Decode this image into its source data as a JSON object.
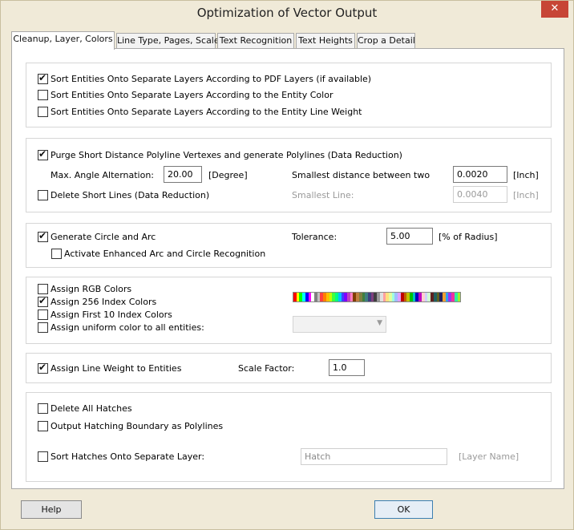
{
  "window": {
    "title": "Optimization of Vector Output",
    "close_glyph": "✕"
  },
  "tabs": [
    {
      "label": "Cleanup, Layer, Colors",
      "active": true
    },
    {
      "label": "Line Type, Pages, Scale",
      "active": false
    },
    {
      "label": "Text Recognition",
      "active": false
    },
    {
      "label": "Text Heights",
      "active": false
    },
    {
      "label": "Crop a Detail",
      "active": false
    }
  ],
  "layers": {
    "pdf_layers": {
      "label": "Sort Entities Onto Separate Layers According to PDF Layers (if available)",
      "checked": true
    },
    "entity_color": {
      "label": "Sort Entities Onto Separate Layers According to the Entity Color",
      "checked": false
    },
    "line_weight": {
      "label": "Sort Entities Onto Separate Layers According to the Entity Line Weight",
      "checked": false
    }
  },
  "reduction": {
    "purge": {
      "label": "Purge Short Distance Polyline Vertexes and generate Polylines (Data Reduction)",
      "checked": true
    },
    "max_angle_label": "Max. Angle Alternation:",
    "max_angle_value": "20.00",
    "max_angle_unit": "[Degree]",
    "smallest_distance_label": "Smallest distance between two",
    "smallest_distance_value": "0.0020",
    "smallest_distance_unit": "[Inch]",
    "delete_short": {
      "label": "Delete Short Lines (Data Reduction)",
      "checked": false
    },
    "smallest_line_label": "Smallest Line:",
    "smallest_line_value": "0.0040",
    "smallest_line_unit": "[Inch]"
  },
  "arcs": {
    "generate": {
      "label": "Generate Circle and Arc",
      "checked": true
    },
    "enhanced": {
      "label": "Activate Enhanced Arc and Circle Recognition",
      "checked": false
    },
    "tolerance_label": "Tolerance:",
    "tolerance_value": "5.00",
    "tolerance_unit": "[% of Radius]"
  },
  "colors": {
    "rgb": {
      "label": "Assign RGB Colors",
      "checked": false
    },
    "index256": {
      "label": "Assign 256 Index Colors",
      "checked": true
    },
    "first10": {
      "label": "Assign First 10 Index Colors",
      "checked": false
    },
    "uniform": {
      "label": "Assign uniform color to all entities:",
      "checked": false
    },
    "palette": [
      "#ff0000",
      "#ffff00",
      "#00ff00",
      "#00ffff",
      "#0000ff",
      "#ff00ff",
      "#ffffff",
      "#808080",
      "#c0c0c0",
      "#ff3f3f",
      "#ff7f00",
      "#ffbf00",
      "#bfff00",
      "#3fff3f",
      "#00ff7f",
      "#00bfff",
      "#3f3fff",
      "#7f00ff",
      "#bf3fbf",
      "#ff7fbf",
      "#7f3f00",
      "#bf7f3f",
      "#7f7f3f",
      "#3f7f3f",
      "#3f7f7f",
      "#3f3f7f",
      "#7f3f7f",
      "#404040",
      "#9a9a9a",
      "#e0e0e0",
      "#ff9f9f",
      "#ffdf7f",
      "#dfff9f",
      "#9fffdf",
      "#9fbfff",
      "#df9fff",
      "#c00000",
      "#c06000",
      "#c0c000",
      "#00c000",
      "#00c0c0",
      "#0000c0",
      "#c000c0",
      "#ffcfcf",
      "#cfcfff",
      "#cfffcf",
      "#602020",
      "#206060",
      "#606020",
      "#202060",
      "#f0a030",
      "#30a0f0",
      "#a030f0",
      "#f030a0",
      "#30f0a0",
      "#a0f030"
    ]
  },
  "lineweight": {
    "assign": {
      "label": "Assign Line Weight to Entities",
      "checked": true
    },
    "scale_label": "Scale Factor:",
    "scale_value": "1.0"
  },
  "hatches": {
    "delete": {
      "label": "Delete All Hatches",
      "checked": false
    },
    "boundary": {
      "label": "Output Hatching Boundary as Polylines",
      "checked": false
    },
    "sort": {
      "label": "Sort Hatches Onto Separate Layer:",
      "checked": false
    },
    "layer_value": "Hatch",
    "layer_hint": "[Layer Name]"
  },
  "buttons": {
    "help": "Help",
    "ok": "OK"
  }
}
